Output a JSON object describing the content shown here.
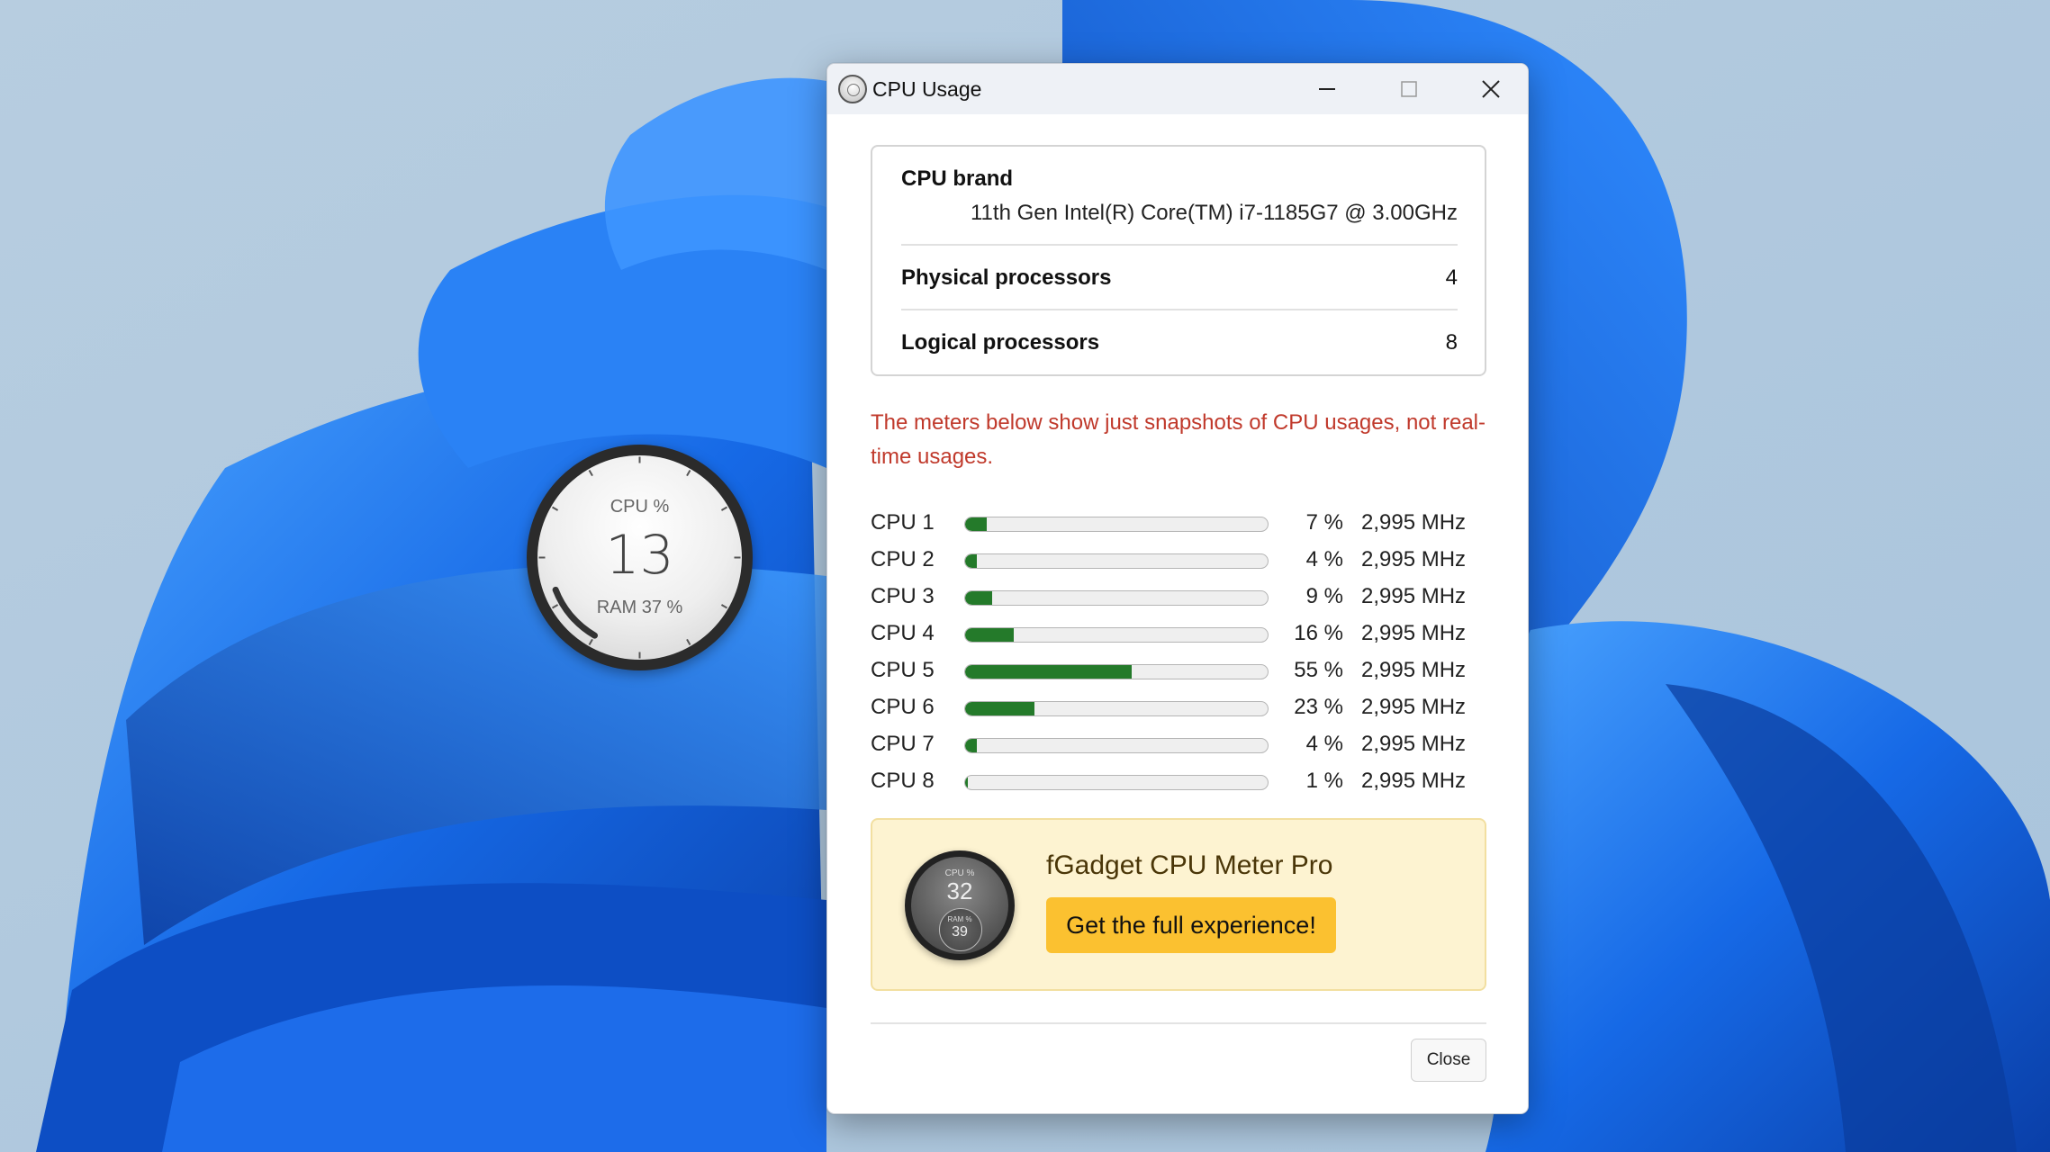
{
  "window": {
    "title": "CPU Usage",
    "icon": "cpu-gadget-icon"
  },
  "info": {
    "brand_label": "CPU brand",
    "brand_value": "11th Gen Intel(R) Core(TM) i7-1185G7 @ 3.00GHz",
    "physical_label": "Physical processors",
    "physical_value": "4",
    "logical_label": "Logical processors",
    "logical_value": "8"
  },
  "notice": "The meters below show just snapshots of CPU usages, not real-time usages.",
  "cpus": [
    {
      "name": "CPU 1",
      "percent": 7,
      "percent_text": "7 %",
      "mhz": "2,995 MHz"
    },
    {
      "name": "CPU 2",
      "percent": 4,
      "percent_text": "4 %",
      "mhz": "2,995 MHz"
    },
    {
      "name": "CPU 3",
      "percent": 9,
      "percent_text": "9 %",
      "mhz": "2,995 MHz"
    },
    {
      "name": "CPU 4",
      "percent": 16,
      "percent_text": "16 %",
      "mhz": "2,995 MHz"
    },
    {
      "name": "CPU 5",
      "percent": 55,
      "percent_text": "55 %",
      "mhz": "2,995 MHz"
    },
    {
      "name": "CPU 6",
      "percent": 23,
      "percent_text": "23 %",
      "mhz": "2,995 MHz"
    },
    {
      "name": "CPU 7",
      "percent": 4,
      "percent_text": "4 %",
      "mhz": "2,995 MHz"
    },
    {
      "name": "CPU 8",
      "percent": 1,
      "percent_text": "1 %",
      "mhz": "2,995 MHz"
    }
  ],
  "promo": {
    "title": "fGadget CPU Meter Pro",
    "button_label": "Get the full experience!",
    "gadget_cpu_label": "CPU %",
    "gadget_cpu_value": "32",
    "gadget_ram_label": "RAM %",
    "gadget_ram_value": "39"
  },
  "footer": {
    "close_label": "Close"
  },
  "desktop_gadget": {
    "cpu_label": "CPU %",
    "cpu_value": "13",
    "cpu_percent": 13,
    "ram_label": "RAM 37 %"
  },
  "colors": {
    "bar_fill": "#247a2a",
    "notice": "#c0392b",
    "promo_bg": "#fdf3d1",
    "promo_button": "#fbc130",
    "wallpaper_blue": "#1a6fe8"
  }
}
